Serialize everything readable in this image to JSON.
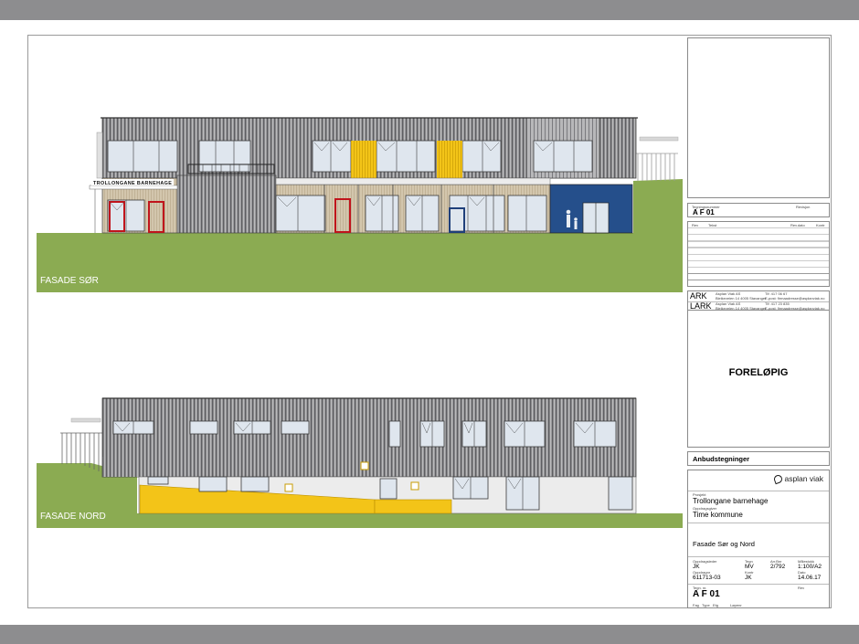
{
  "elevations": {
    "south_label": "FASADE SØR",
    "north_label": "FASADE NORD",
    "building_sign": "TROLLONGANE BARNEHAGE"
  },
  "title_block": {
    "drawing_no_label": "Tegningsnummer",
    "drawing_no": "A F 01",
    "revision_label": "Revisjon",
    "rev_col_rev": "Rev",
    "rev_col_text": "Tekst",
    "rev_col_date": "Rev.dato",
    "rev_col_sign": "Kontr",
    "consultants": [
      {
        "code": "ARK",
        "company": "Asplan Viak AS",
        "address": "Bleikeveien 14 4005 Stavanger",
        "phone": "Tlf: 417 06 67",
        "email": "E-post: firmaadresse@asplanviak.no"
      },
      {
        "code": "LARK",
        "company": "Asplan Viak AS",
        "address": "Bleikeveien 14 4005 Stavanger",
        "phone": "Tlf: 417 23 835",
        "email": "E-post: firmaadresse@asplanviak.no"
      }
    ],
    "status": "FORELØPIG",
    "purpose": "Anbudstegninger",
    "logo": "asplan viak",
    "project_label": "Prosjekt",
    "project": "Trollongane barnehage",
    "client_label": "Oppdragsgiver",
    "client": "Time kommune",
    "drawing_title": "Fasade Sør og Nord",
    "meta": [
      {
        "label": "Oppdragsleder",
        "value": "JK"
      },
      {
        "label": "Tegn",
        "value": "MV"
      },
      {
        "label": "Arr.Bnr",
        "value": "2/792"
      },
      {
        "label": "Målestokk",
        "value": "1:100/A2"
      },
      {
        "label": "Oppdragnr",
        "value": "611713-03"
      },
      {
        "label": "Kontr",
        "value": "JK"
      },
      {
        "label": "Dato",
        "value": "14.06.17"
      }
    ],
    "drawing_no_label2": "Tegn. nr.",
    "drawing_no2": "A F 01",
    "rev_label2": "Rev",
    "footer_fields": [
      "Fag",
      "Type",
      "Etg",
      "Løpenr"
    ]
  }
}
